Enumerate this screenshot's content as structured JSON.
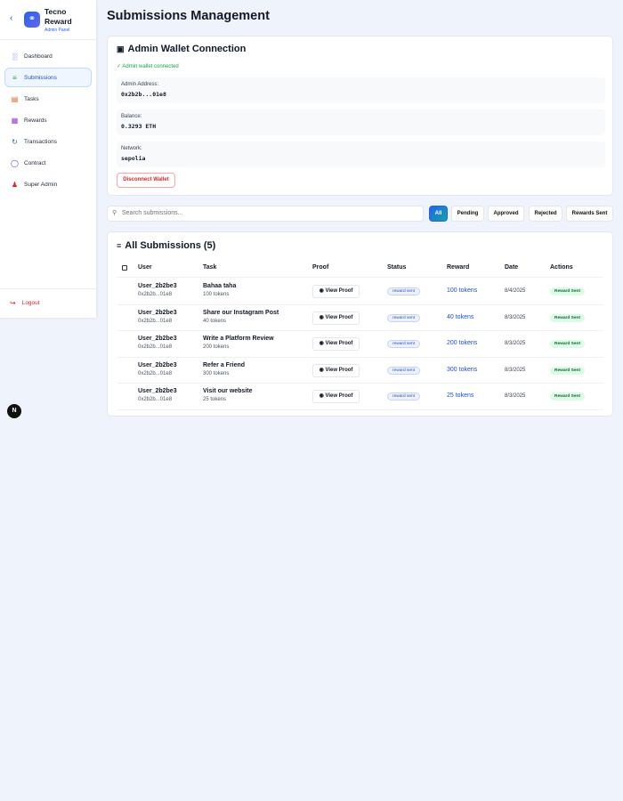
{
  "sidebar": {
    "brand": "Tecno Reward",
    "subtitle": "Admin Panel",
    "items": [
      {
        "label": "Dashboard",
        "icon": "bar-chart-icon",
        "color": "#1d4ed8"
      },
      {
        "label": "Submissions",
        "icon": "list-check-icon",
        "color": "#16a34a"
      },
      {
        "label": "Tasks",
        "icon": "file-icon",
        "color": "#ea580c"
      },
      {
        "label": "Rewards",
        "icon": "gift-icon",
        "color": "#9333ea"
      },
      {
        "label": "Transactions",
        "icon": "history-icon",
        "color": "#0e7490"
      },
      {
        "label": "Contract",
        "icon": "shield-icon",
        "color": "#4f46e5"
      },
      {
        "label": "Super Admin",
        "icon": "user-icon",
        "color": "#dc2626"
      }
    ],
    "logout": "Logout"
  },
  "page": {
    "title": "Submissions Management"
  },
  "wallet": {
    "title": "Admin Wallet Connection",
    "status": "Admin wallet connected",
    "address_label": "Admin Address:",
    "address": "0x2b2b...01e8",
    "balance_label": "Balance:",
    "balance": "0.3293 ETH",
    "network_label": "Network:",
    "network": "sepolia",
    "disconnect": "Disconnect Wallet"
  },
  "search": {
    "placeholder": "Search submissions..."
  },
  "filters": [
    "All",
    "Pending",
    "Approved",
    "Rejected",
    "Rewards Sent"
  ],
  "table": {
    "title": "All Submissions (5)",
    "headers": [
      "User",
      "Task",
      "Proof",
      "Status",
      "Reward",
      "Date",
      "Actions"
    ],
    "rows": [
      {
        "user": "User_2b2be3",
        "addr": "0x2b2b...01e8",
        "task": "Bahaa taha",
        "tokens": "100 tokens",
        "proof": "View Proof",
        "status": "reward sent",
        "reward": "100 tokens",
        "date": "8/4/2025",
        "action": "Reward Sent"
      },
      {
        "user": "User_2b2be3",
        "addr": "0x2b2b...01e8",
        "task": "Share our Instagram Post",
        "tokens": "40 tokens",
        "proof": "View Proof",
        "status": "reward sent",
        "reward": "40 tokens",
        "date": "8/3/2025",
        "action": "Reward Sent"
      },
      {
        "user": "User_2b2be3",
        "addr": "0x2b2b...01e8",
        "task": "Write a Platform Review",
        "tokens": "200 tokens",
        "proof": "View Proof",
        "status": "reward sent",
        "reward": "200 tokens",
        "date": "8/3/2025",
        "action": "Reward Sent"
      },
      {
        "user": "User_2b2be3",
        "addr": "0x2b2b...01e8",
        "task": "Refer a Friend",
        "tokens": "300 tokens",
        "proof": "View Proof",
        "status": "reward sent",
        "reward": "300 tokens",
        "date": "8/3/2025",
        "action": "Reward Sent"
      },
      {
        "user": "User_2b2be3",
        "addr": "0x2b2b...01e8",
        "task": "Visit our website",
        "tokens": "25 tokens",
        "proof": "View Proof",
        "status": "reward sent",
        "reward": "25 tokens",
        "date": "8/3/2025",
        "action": "Reward Sent"
      }
    ]
  },
  "badge": "N"
}
